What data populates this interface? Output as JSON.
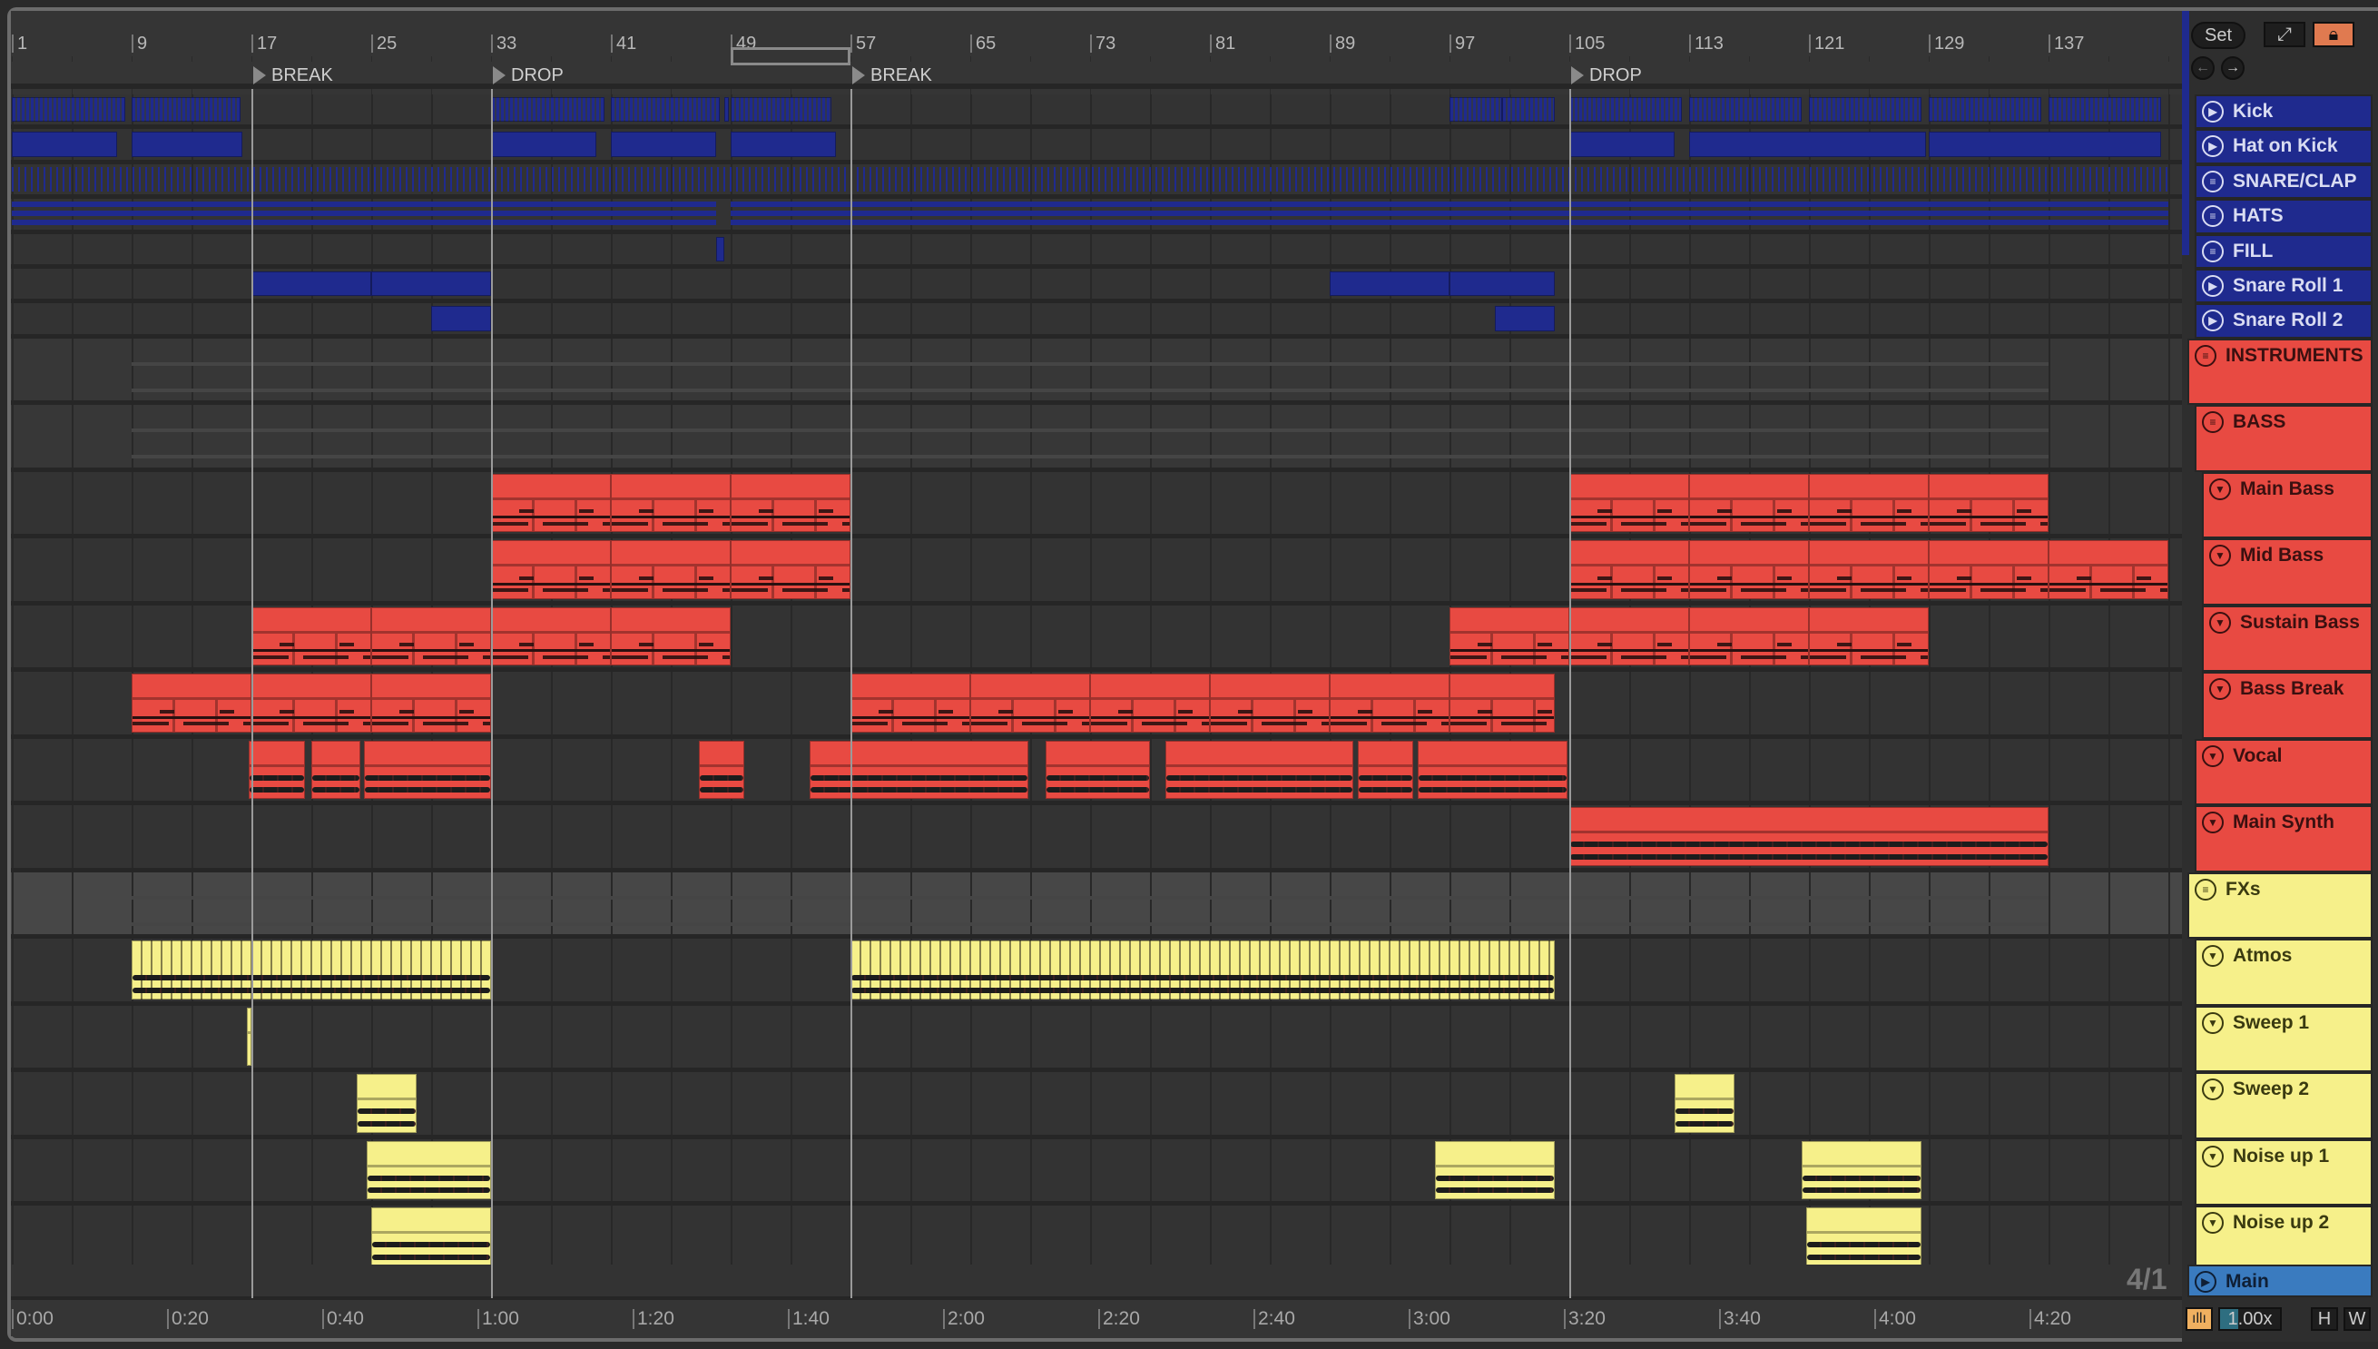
{
  "ruler": {
    "bars": [
      "1",
      "9",
      "17",
      "25",
      "33",
      "41",
      "49",
      "57",
      "65",
      "73",
      "81",
      "89",
      "97",
      "105",
      "113",
      "121",
      "129",
      "137"
    ]
  },
  "locators": [
    {
      "bar": 17,
      "label": "BREAK"
    },
    {
      "bar": 33,
      "label": "DROP"
    },
    {
      "bar": 57,
      "label": "BREAK"
    },
    {
      "bar": 105,
      "label": "DROP"
    }
  ],
  "loop": {
    "start": 49,
    "end": 57
  },
  "time_labels": [
    "0:00",
    "0:20",
    "0:40",
    "1:00",
    "1:20",
    "1:40",
    "2:00",
    "2:20",
    "2:40",
    "3:00",
    "3:20",
    "3:40",
    "4:00",
    "4:20"
  ],
  "controls": {
    "set": "Set",
    "grid": "4/1",
    "zoom": "1.00x",
    "h": "H",
    "w": "W"
  },
  "colors": {
    "drums": "#1f2a8e",
    "instruments": "#e84a42",
    "fx": "#f6f08a",
    "main": "#3a7bbf",
    "lock": "#e07a50",
    "audio_btn": "#f0b060"
  },
  "tracks": [
    {
      "name": "Kick",
      "icon": "play",
      "col": "blue",
      "lvl": 1,
      "h": "s",
      "pat": "beats",
      "clips": [
        [
          1,
          8.6
        ],
        [
          9,
          16.3
        ],
        [
          33,
          40.6
        ],
        [
          41,
          48.3
        ],
        [
          48.6,
          48.9
        ],
        [
          49,
          55.7
        ],
        [
          97,
          100.5
        ],
        [
          100.5,
          104
        ],
        [
          105,
          112.5
        ],
        [
          113,
          120.5
        ],
        [
          121,
          128.5
        ],
        [
          129,
          136.5
        ],
        [
          137,
          144.5
        ]
      ]
    },
    {
      "name": "Hat on Kick",
      "icon": "play",
      "col": "blue",
      "lvl": 1,
      "h": "s",
      "pat": "solid",
      "clips": [
        [
          1,
          8
        ],
        [
          9,
          16.4
        ],
        [
          33,
          40
        ],
        [
          41,
          48
        ],
        [
          49,
          56
        ],
        [
          105,
          112
        ],
        [
          113,
          128.8
        ],
        [
          129,
          144.5
        ]
      ]
    },
    {
      "name": "SNARE/CLAP",
      "icon": "group",
      "col": "blue",
      "lvl": 1,
      "h": "s",
      "pat": "ticks",
      "clips": [
        [
          1,
          145
        ]
      ]
    },
    {
      "name": "HATS",
      "icon": "group",
      "col": "blue",
      "lvl": 1,
      "h": "s",
      "pat": "hatsline",
      "clips": [
        [
          1,
          33
        ],
        [
          33,
          48
        ],
        [
          49,
          145
        ]
      ]
    },
    {
      "name": "FILL",
      "icon": "group",
      "col": "blue",
      "lvl": 1,
      "h": "s",
      "pat": "solid",
      "clips": [
        [
          48,
          48.6
        ]
      ]
    },
    {
      "name": "Snare Roll 1",
      "icon": "play",
      "col": "blue",
      "lvl": 1,
      "h": "s",
      "pat": "solid",
      "clips": [
        [
          17,
          25
        ],
        [
          25,
          33
        ],
        [
          89,
          97
        ],
        [
          97,
          104
        ]
      ]
    },
    {
      "name": "Snare Roll 2",
      "icon": "play",
      "col": "blue",
      "lvl": 1,
      "h": "s",
      "pat": "solid",
      "clips": [
        [
          29,
          33
        ],
        [
          100,
          104
        ]
      ]
    },
    {
      "name": "INSTRUMENTS",
      "icon": "group",
      "col": "red",
      "lvl": 0,
      "h": "l",
      "pat": "group",
      "clips": []
    },
    {
      "name": "BASS",
      "icon": "group",
      "col": "red",
      "lvl": 1,
      "h": "l",
      "pat": "group",
      "clips": []
    },
    {
      "name": "Main Bass",
      "icon": "fold",
      "col": "red",
      "lvl": 2,
      "h": "l",
      "pat": "midi",
      "clips": [
        [
          33,
          41
        ],
        [
          41,
          49
        ],
        [
          49,
          57
        ],
        [
          105,
          113
        ],
        [
          113,
          121
        ],
        [
          121,
          129
        ],
        [
          129,
          137
        ]
      ]
    },
    {
      "name": "Mid Bass",
      "icon": "fold",
      "col": "red",
      "lvl": 2,
      "h": "l",
      "pat": "midi",
      "clips": [
        [
          33,
          41
        ],
        [
          41,
          49
        ],
        [
          49,
          57
        ],
        [
          105,
          113
        ],
        [
          113,
          121
        ],
        [
          121,
          129
        ],
        [
          129,
          137
        ],
        [
          137,
          145
        ]
      ]
    },
    {
      "name": "Sustain Bass",
      "icon": "fold",
      "col": "red",
      "lvl": 2,
      "h": "l",
      "pat": "midi",
      "clips": [
        [
          17,
          25
        ],
        [
          25,
          33
        ],
        [
          33,
          41
        ],
        [
          41,
          49
        ],
        [
          97,
          105
        ],
        [
          105,
          113
        ],
        [
          113,
          121
        ],
        [
          121,
          129
        ]
      ]
    },
    {
      "name": "Bass Break",
      "icon": "fold",
      "col": "red",
      "lvl": 2,
      "h": "l",
      "pat": "midi",
      "clips": [
        [
          9,
          17
        ],
        [
          17,
          25
        ],
        [
          25,
          33
        ],
        [
          57,
          65
        ],
        [
          65,
          73
        ],
        [
          73,
          81
        ],
        [
          81,
          89
        ],
        [
          89,
          97
        ],
        [
          97,
          104
        ]
      ]
    },
    {
      "name": "Vocal",
      "icon": "fold",
      "col": "red",
      "lvl": 1,
      "h": "l",
      "pat": "audio",
      "clips": [
        [
          16.8,
          20.6
        ],
        [
          21,
          24.3
        ],
        [
          24.5,
          33
        ],
        [
          46.9,
          49.9
        ],
        [
          54.3,
          68.9
        ],
        [
          70,
          77
        ],
        [
          78,
          90.6
        ],
        [
          90.9,
          94.6
        ],
        [
          94.9,
          104.9
        ]
      ]
    },
    {
      "name": "Main Synth",
      "icon": "fold",
      "col": "red",
      "lvl": 1,
      "h": "l",
      "pat": "audio",
      "clips": [
        [
          105,
          137
        ]
      ]
    },
    {
      "name": "FXs",
      "icon": "group",
      "col": "yel",
      "lvl": 0,
      "h": "l",
      "pat": "fxgroup",
      "clips": []
    },
    {
      "name": "Atmos",
      "icon": "fold",
      "col": "yel",
      "lvl": 1,
      "h": "l",
      "pat": "atmos",
      "clips": [
        [
          9,
          33
        ],
        [
          57,
          104
        ]
      ]
    },
    {
      "name": "Sweep 1",
      "icon": "fold",
      "col": "yel",
      "lvl": 1,
      "h": "l",
      "pat": "solid",
      "clips": [
        [
          16.7,
          17
        ]
      ]
    },
    {
      "name": "Sweep 2",
      "icon": "fold",
      "col": "yel",
      "lvl": 1,
      "h": "l",
      "pat": "audio",
      "clips": [
        [
          24,
          28
        ],
        [
          112,
          116
        ]
      ]
    },
    {
      "name": "Noise up 1",
      "icon": "fold",
      "col": "yel",
      "lvl": 1,
      "h": "l",
      "pat": "audio",
      "clips": [
        [
          24.7,
          33
        ],
        [
          96,
          104
        ],
        [
          120.5,
          128.5
        ]
      ]
    },
    {
      "name": "Noise up 2",
      "icon": "fold",
      "col": "yel",
      "lvl": 1,
      "h": "l",
      "pat": "audio",
      "clips": [
        [
          25,
          33
        ],
        [
          120.8,
          128.5
        ]
      ]
    }
  ],
  "main_track": {
    "name": "Main"
  }
}
